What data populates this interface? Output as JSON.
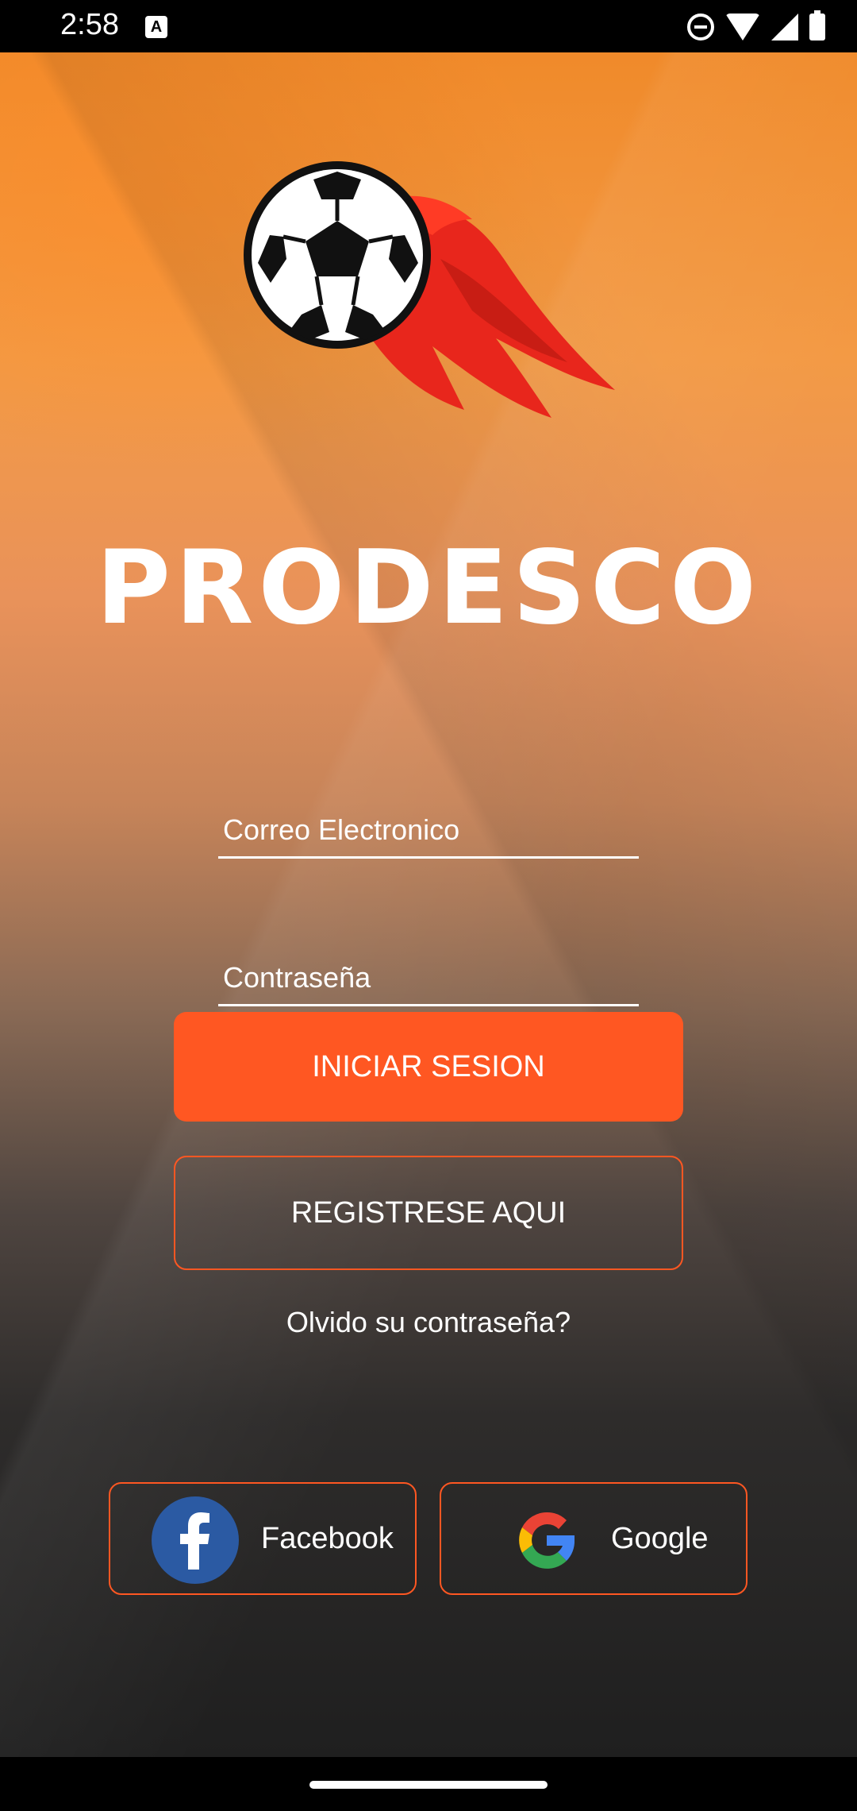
{
  "status_bar": {
    "time": "2:58",
    "notification_icon": "A",
    "icons": [
      "do-not-disturb-icon",
      "wifi-icon",
      "signal-icon",
      "battery-icon"
    ]
  },
  "app": {
    "logo": "flaming-soccer-ball-icon",
    "brand_name": "PRODESCO"
  },
  "login_form": {
    "email_placeholder": "Correo Electronico",
    "email_value": "",
    "password_placeholder": "Contraseña",
    "password_value": "",
    "login_label": "INICIAR SESION",
    "register_label": "REGISTRESE AQUI",
    "forgot_label": "Olvido su contraseña?"
  },
  "social_login": {
    "facebook_label": "Facebook",
    "google_label": "Google"
  },
  "colors": {
    "accent": "#ff5722",
    "background_top": "#f08a2a",
    "background_bottom": "#1f1f1f",
    "facebook": "#2b5aa3"
  }
}
